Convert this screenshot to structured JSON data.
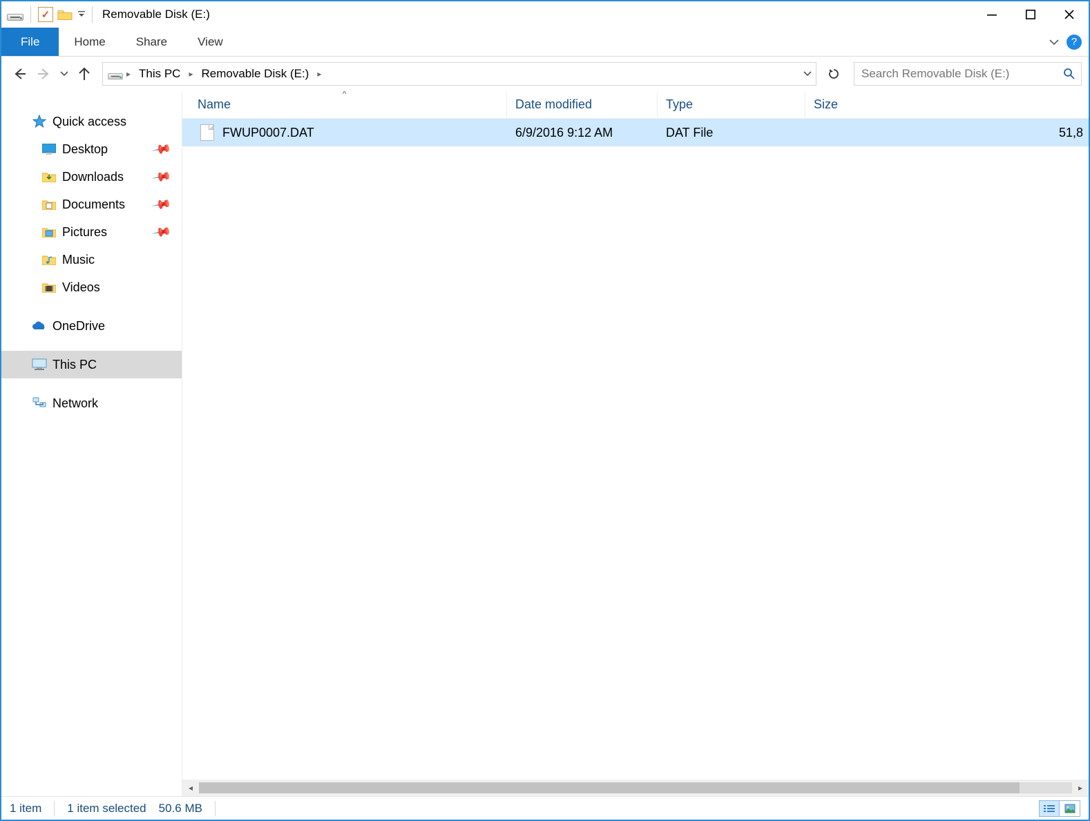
{
  "titlebar": {
    "title": "Removable Disk (E:)"
  },
  "ribbon": {
    "file": "File",
    "home": "Home",
    "share": "Share",
    "view": "View"
  },
  "address": {
    "this_pc": "This PC",
    "location": "Removable Disk (E:)"
  },
  "search": {
    "placeholder": "Search Removable Disk (E:)"
  },
  "navpane": {
    "quick_access": "Quick access",
    "desktop": "Desktop",
    "downloads": "Downloads",
    "documents": "Documents",
    "pictures": "Pictures",
    "music": "Music",
    "videos": "Videos",
    "onedrive": "OneDrive",
    "this_pc": "This PC",
    "network": "Network"
  },
  "columns": {
    "name": "Name",
    "date": "Date modified",
    "type": "Type",
    "size": "Size"
  },
  "files": [
    {
      "name": "FWUP0007.DAT",
      "date": "6/9/2016 9:12 AM",
      "type": "DAT File",
      "size": "51,8",
      "selected": true
    }
  ],
  "status": {
    "count": "1 item",
    "selected": "1 item selected",
    "size": "50.6 MB"
  }
}
